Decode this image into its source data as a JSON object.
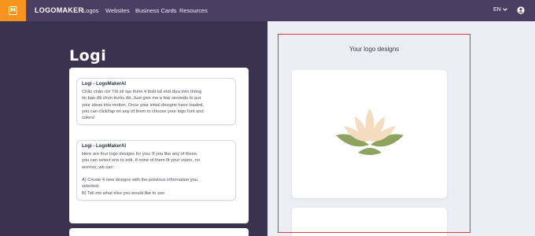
{
  "header": {
    "brand_badge": "M",
    "logo_text": "LOGOMAKER",
    "nav": [
      "Logos",
      "Websites",
      "Business Cards",
      "Resources"
    ],
    "language": "EN",
    "icons": [
      "logomaker-badge-icon",
      "chevron-down-icon",
      "user-icon"
    ]
  },
  "chat": {
    "brand": "Logi",
    "messages": [
      {
        "sender": "Logi - LogoMakerAI",
        "text": "Chắc chắn rồi! Tôi sẽ tạo thêm 4 thiết kế mới dựa trên thông\ntin bạn đã chọn trước đó. Just give me a few seconds to put\nyour ideas into motion. Once your initial designs have loaded,\nyou can click/tap on any of them to choose your logo font and\ncolors!"
      },
      {
        "sender": "Logi - LogoMakerAI",
        "text": "Here are four logo designs for you. If you like any of these,\nyou can select one to edit. If none of them fit your vision, no\nworries, we can:\n\nA) Create 4 new designs with the previous information you\nselected\nB) Tell me what else you would like to see"
      }
    ]
  },
  "designs": {
    "title": "Your logo designs",
    "highlight_color": "#e03a3a",
    "logo_icon": "lotus-icon",
    "colors": {
      "petal": "#f3dcc0",
      "leaf": "#8ea35d"
    }
  }
}
